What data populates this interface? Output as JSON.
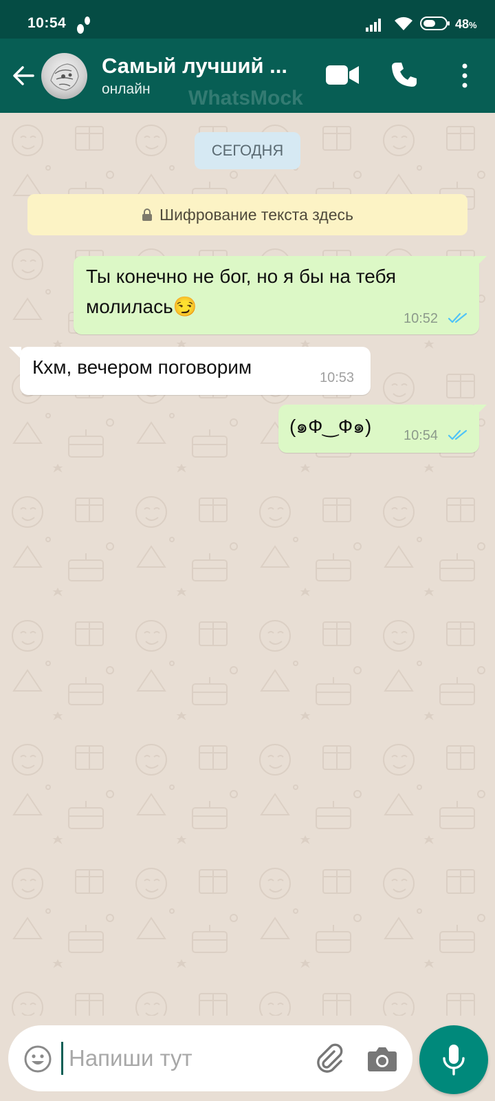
{
  "status_bar": {
    "time": "10:54",
    "battery_percent": "48",
    "battery_suffix": "%"
  },
  "header": {
    "contact_name": "Самый лучший ...",
    "contact_status": "онлайн",
    "watermark": "WhatsMock"
  },
  "chat": {
    "date_label": "СЕГОДНЯ",
    "encryption_notice": "Шифрование текста здесь",
    "messages": [
      {
        "direction": "outgoing",
        "line1": "Ты конечно не бог, но я бы на тебя",
        "line2": "молилась",
        "emoji": "😏",
        "time": "10:52",
        "read": true
      },
      {
        "direction": "incoming",
        "text": "Кхм, вечером поговорим",
        "time": "10:53"
      },
      {
        "direction": "outgoing",
        "text": "(๑Ф‿Ф๑)",
        "time": "10:54",
        "read": true
      }
    ]
  },
  "composer": {
    "placeholder": "Напиши тут"
  },
  "colors": {
    "header": "#075e54",
    "status_bar": "#054c44",
    "outgoing_bubble": "#dcf8c6",
    "incoming_bubble": "#ffffff",
    "chat_background": "#e8ded4",
    "read_ticks": "#4fc3f7",
    "mic_button": "#00897b"
  },
  "icons": [
    "dnd-icon",
    "signal-icon",
    "wifi-icon",
    "battery-icon",
    "back-arrow-icon",
    "video-call-icon",
    "phone-call-icon",
    "more-vert-icon",
    "lock-icon",
    "double-check-icon",
    "emoji-icon",
    "attach-icon",
    "camera-icon",
    "mic-icon"
  ]
}
